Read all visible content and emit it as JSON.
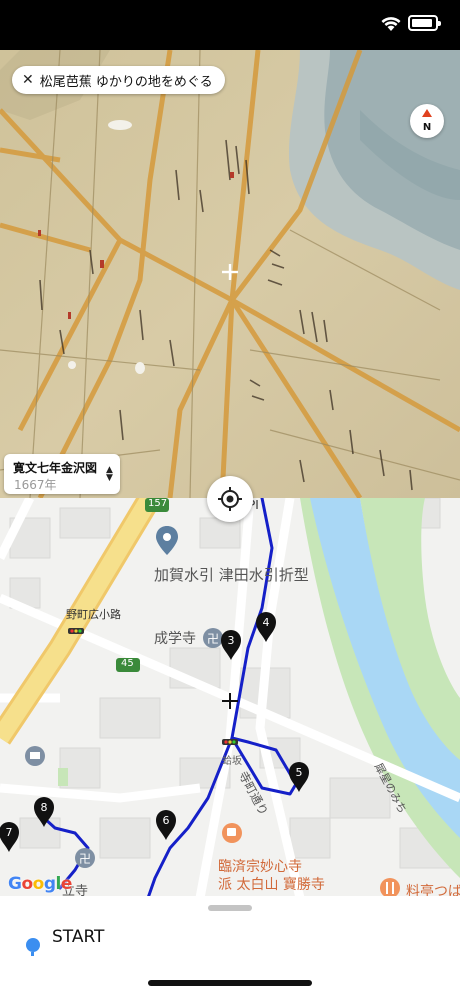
{
  "status_bar": {
    "icons": [
      "wifi-icon",
      "battery-icon"
    ]
  },
  "old_map": {
    "title": "松尾芭蕉 ゆかりの地をめぐる",
    "close_symbol": "✕",
    "compass_label": "N",
    "map_selector": {
      "name": "寛文七年金沢図",
      "year": "1667年",
      "icon": "chevron-up-down-icon"
    }
  },
  "modern_map": {
    "labels": {
      "road_157": "157",
      "road_45": "45",
      "place_kaga": "加賀水引 津田水引折型",
      "place_nomachi": "野町広小路",
      "place_seigaku": "成学寺",
      "place_tera": "寺町通り",
      "place_saigawa": "犀星のみち",
      "place_rinzai_1": "臨済宗妙心寺",
      "place_rinzai_2": "派 太白山 寶勝寺",
      "place_ryotei": "料亭つば",
      "place_gakuritsu": "立寺",
      "place_partial": "PI",
      "place_saka": "蛤坂"
    },
    "markers": [
      "3",
      "4",
      "5",
      "6",
      "7",
      "8"
    ],
    "google": [
      "G",
      "o",
      "o",
      "g",
      "l",
      "e"
    ],
    "colors": {
      "route": "#1520c8",
      "river": "#a9d7f5",
      "park": "#c7e6b8",
      "major_road": "#f6e08c"
    }
  },
  "sheet": {
    "start_label": "START"
  }
}
